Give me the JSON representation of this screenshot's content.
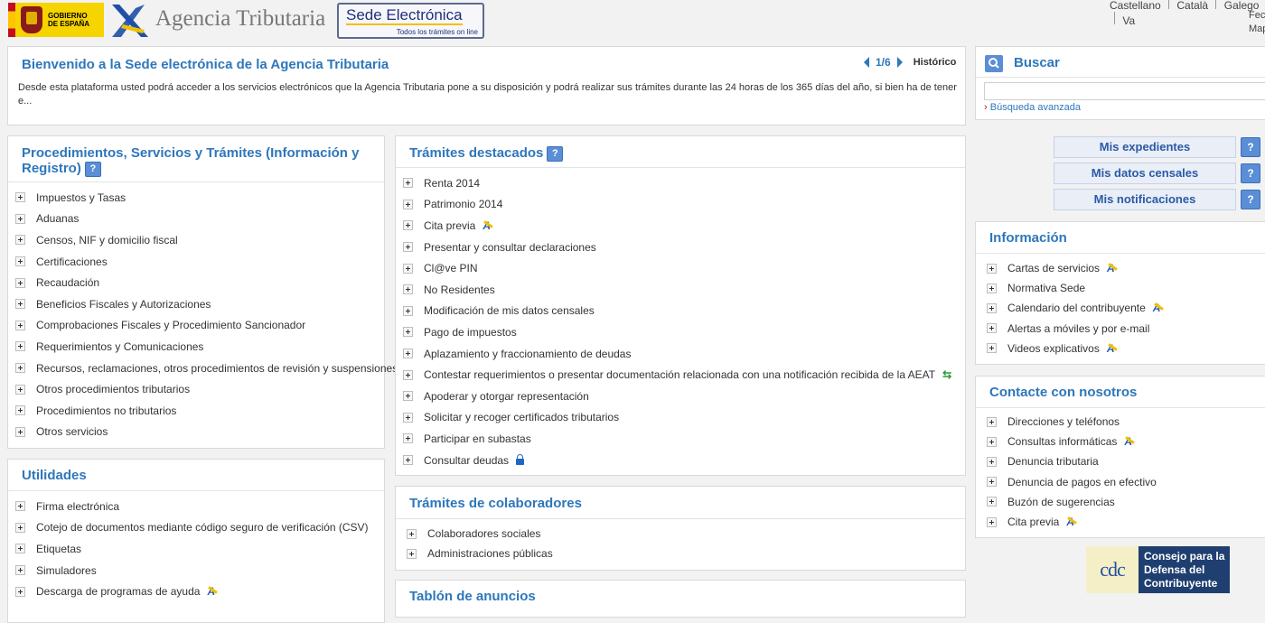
{
  "header": {
    "gov_label": "GOBIERNO DE ESPAÑA",
    "agency_name": "Agencia Tributaria",
    "sede_title": "Sede Electrónica",
    "sede_tagline": "Todos los trámites on line",
    "languages": [
      "Castellano",
      "Català",
      "Galego",
      "Va"
    ],
    "right_lines": [
      "Fec",
      "Map"
    ]
  },
  "welcome": {
    "title": "Bienvenido a la Sede electrónica de la Agencia Tributaria",
    "pager": "1/6",
    "historico": "Histórico",
    "text": "Desde esta plataforma usted podrá acceder a los servicios electrónicos que la Agencia Tributaria pone a su disposición y podrá realizar sus trámites durante las 24 horas de los 365 días del año, si bien ha de tener e..."
  },
  "buscar": {
    "title": "Buscar",
    "input_value": "",
    "advanced": "Búsqueda avanzada"
  },
  "procedimientos": {
    "title_line1": "Procedimientos, Servicios y Trámites (Información y",
    "title_line2": "Registro)",
    "items": [
      "Impuestos y Tasas",
      "Aduanas",
      "Censos, NIF y domicilio fiscal",
      "Certificaciones",
      "Recaudación",
      "Beneficios Fiscales y Autorizaciones",
      "Comprobaciones Fiscales y Procedimiento Sancionador",
      "Requerimientos y Comunicaciones",
      "Recursos, reclamaciones, otros procedimientos de revisión y suspensiones",
      "Otros procedimientos tributarios",
      "Procedimientos no tributarios",
      "Otros servicios"
    ]
  },
  "utilidades": {
    "title": "Utilidades",
    "items": [
      {
        "label": "Firma electrónica",
        "icon": ""
      },
      {
        "label": "Cotejo de documentos mediante código seguro de verificación (CSV)",
        "icon": ""
      },
      {
        "label": "Etiquetas",
        "icon": ""
      },
      {
        "label": "Simuladores",
        "icon": ""
      },
      {
        "label": "Descarga de programas de ayuda",
        "icon": "aeat-icon"
      }
    ]
  },
  "destacados": {
    "title": "Trámites destacados",
    "items": [
      {
        "label": "Renta 2014",
        "icon": ""
      },
      {
        "label": "Patrimonio 2014",
        "icon": ""
      },
      {
        "label": "Cita previa",
        "icon": "aeat-icon"
      },
      {
        "label": "Presentar y consultar declaraciones",
        "icon": ""
      },
      {
        "label": "Cl@ve PIN",
        "icon": ""
      },
      {
        "label": "No Residentes",
        "icon": ""
      },
      {
        "label": "Modificación de mis datos censales",
        "icon": ""
      },
      {
        "label": "Pago de impuestos",
        "icon": ""
      },
      {
        "label": "Aplazamiento y fraccionamiento de deudas",
        "icon": ""
      },
      {
        "label": "Contestar requerimientos o presentar documentación relacionada con una notificación recibida de la AEAT",
        "icon": "swap-icon"
      },
      {
        "label": "Apoderar y otorgar representación",
        "icon": ""
      },
      {
        "label": "Solicitar y recoger certificados tributarios",
        "icon": ""
      },
      {
        "label": "Participar en subastas",
        "icon": ""
      },
      {
        "label": "Consultar deudas",
        "icon": "lock-icon"
      }
    ]
  },
  "colaboradores": {
    "title": "Trámites de colaboradores",
    "items": [
      "Colaboradores sociales",
      "Administraciones públicas"
    ]
  },
  "tablon": {
    "title": "Tablón de anuncios"
  },
  "quick_buttons": [
    {
      "label": "Mis expedientes",
      "help": "?"
    },
    {
      "label": "Mis datos censales",
      "help": "?"
    },
    {
      "label": "Mis notificaciones",
      "help": "?"
    }
  ],
  "informacion": {
    "title": "Información",
    "items": [
      {
        "label": "Cartas de servicios",
        "icon": "aeat-icon"
      },
      {
        "label": "Normativa Sede",
        "icon": ""
      },
      {
        "label": "Calendario del contribuyente",
        "icon": "aeat-icon"
      },
      {
        "label": "Alertas a móviles y por e-mail",
        "icon": ""
      },
      {
        "label": "Videos explicativos",
        "icon": "aeat-icon"
      }
    ]
  },
  "contacte": {
    "title": "Contacte con nosotros",
    "items": [
      {
        "label": "Direcciones y teléfonos",
        "icon": ""
      },
      {
        "label": "Consultas informáticas",
        "icon": "aeat-icon"
      },
      {
        "label": "Denuncia tributaria",
        "icon": ""
      },
      {
        "label": "Denuncia de pagos en efectivo",
        "icon": ""
      },
      {
        "label": "Buzón de sugerencias",
        "icon": ""
      },
      {
        "label": "Cita previa",
        "icon": "aeat-icon"
      }
    ]
  },
  "consejo": {
    "lines": [
      "Consejo para la",
      "Defensa del",
      "Contribuyente"
    ],
    "logo_letters": "cdc"
  },
  "colors": {
    "link_blue": "#2e77bb",
    "accent_yellow": "#f0c000",
    "panel_border": "#d9d9d9"
  }
}
